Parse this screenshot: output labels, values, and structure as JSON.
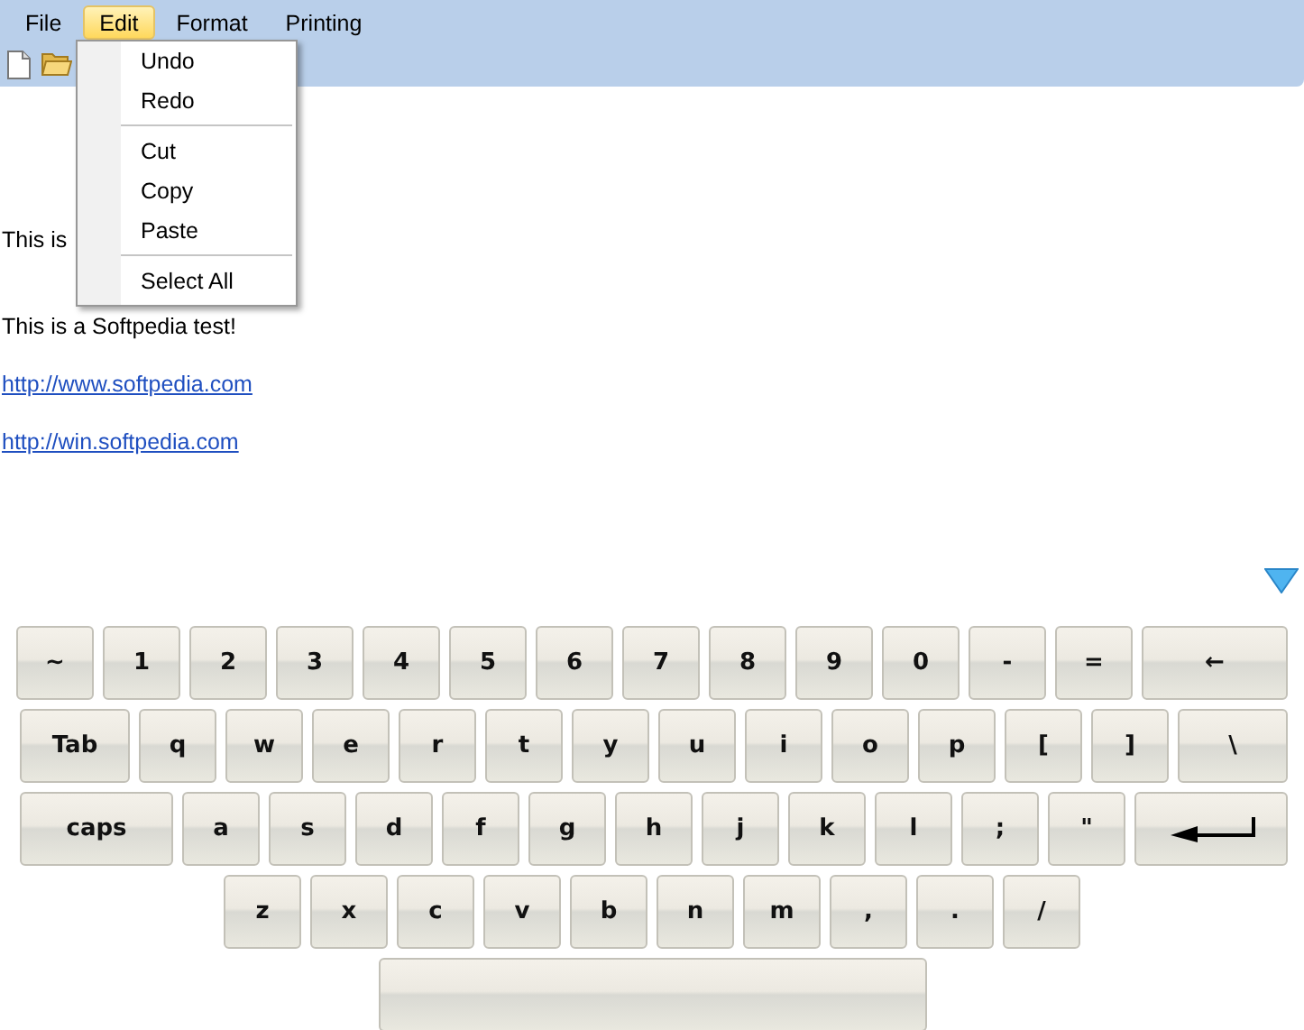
{
  "menu_bar": [
    {
      "label": "File",
      "selected": false
    },
    {
      "label": "Edit",
      "selected": true
    },
    {
      "label": "Format",
      "selected": false
    },
    {
      "label": "Printing",
      "selected": false
    }
  ],
  "edit_menu": {
    "groups": [
      [
        "Undo",
        "Redo"
      ],
      [
        "Cut",
        "Copy",
        "Paste"
      ],
      [
        "Select All"
      ]
    ]
  },
  "document": [
    {
      "kind": "text",
      "text": "This is"
    },
    {
      "kind": "text",
      "text": "This is a Softpedia test!"
    },
    {
      "kind": "link",
      "text": "http://www.softpedia.com"
    },
    {
      "kind": "link",
      "text": "http://win.softpedia.com"
    }
  ],
  "keyboard": {
    "rows": [
      [
        {
          "kind": "char",
          "label": "~"
        },
        {
          "kind": "char",
          "label": "1"
        },
        {
          "kind": "char",
          "label": "2"
        },
        {
          "kind": "char",
          "label": "3"
        },
        {
          "kind": "char",
          "label": "4"
        },
        {
          "kind": "char",
          "label": "5"
        },
        {
          "kind": "char",
          "label": "6"
        },
        {
          "kind": "char",
          "label": "7"
        },
        {
          "kind": "char",
          "label": "8"
        },
        {
          "kind": "char",
          "label": "9"
        },
        {
          "kind": "char",
          "label": "0"
        },
        {
          "kind": "char",
          "label": "-"
        },
        {
          "kind": "char",
          "label": "="
        },
        {
          "kind": "wide",
          "label": "←"
        }
      ],
      [
        {
          "kind": "wide",
          "label": "Tab"
        },
        {
          "kind": "char",
          "label": "q"
        },
        {
          "kind": "char",
          "label": "w"
        },
        {
          "kind": "char",
          "label": "e"
        },
        {
          "kind": "char",
          "label": "r"
        },
        {
          "kind": "char",
          "label": "t"
        },
        {
          "kind": "char",
          "label": "y"
        },
        {
          "kind": "char",
          "label": "u"
        },
        {
          "kind": "char",
          "label": "i"
        },
        {
          "kind": "char",
          "label": "o"
        },
        {
          "kind": "char",
          "label": "p"
        },
        {
          "kind": "char",
          "label": "["
        },
        {
          "kind": "char",
          "label": "]"
        },
        {
          "kind": "wide",
          "label": "\\"
        }
      ],
      [
        {
          "kind": "wide",
          "label": "caps"
        },
        {
          "kind": "char",
          "label": "a"
        },
        {
          "kind": "char",
          "label": "s"
        },
        {
          "kind": "char",
          "label": "d"
        },
        {
          "kind": "char",
          "label": "f"
        },
        {
          "kind": "char",
          "label": "g"
        },
        {
          "kind": "char",
          "label": "h"
        },
        {
          "kind": "char",
          "label": "j"
        },
        {
          "kind": "char",
          "label": "k"
        },
        {
          "kind": "char",
          "label": "l"
        },
        {
          "kind": "char",
          "label": ";"
        },
        {
          "kind": "char",
          "label": "\""
        },
        {
          "kind": "enter"
        }
      ],
      [
        {
          "kind": "char",
          "label": "z"
        },
        {
          "kind": "char",
          "label": "x"
        },
        {
          "kind": "char",
          "label": "c"
        },
        {
          "kind": "char",
          "label": "v"
        },
        {
          "kind": "char",
          "label": "b"
        },
        {
          "kind": "char",
          "label": "n"
        },
        {
          "kind": "char",
          "label": "m"
        },
        {
          "kind": "char",
          "label": ","
        },
        {
          "kind": "char",
          "label": "."
        },
        {
          "kind": "char",
          "label": "/"
        }
      ],
      [
        {
          "kind": "space"
        }
      ]
    ]
  }
}
